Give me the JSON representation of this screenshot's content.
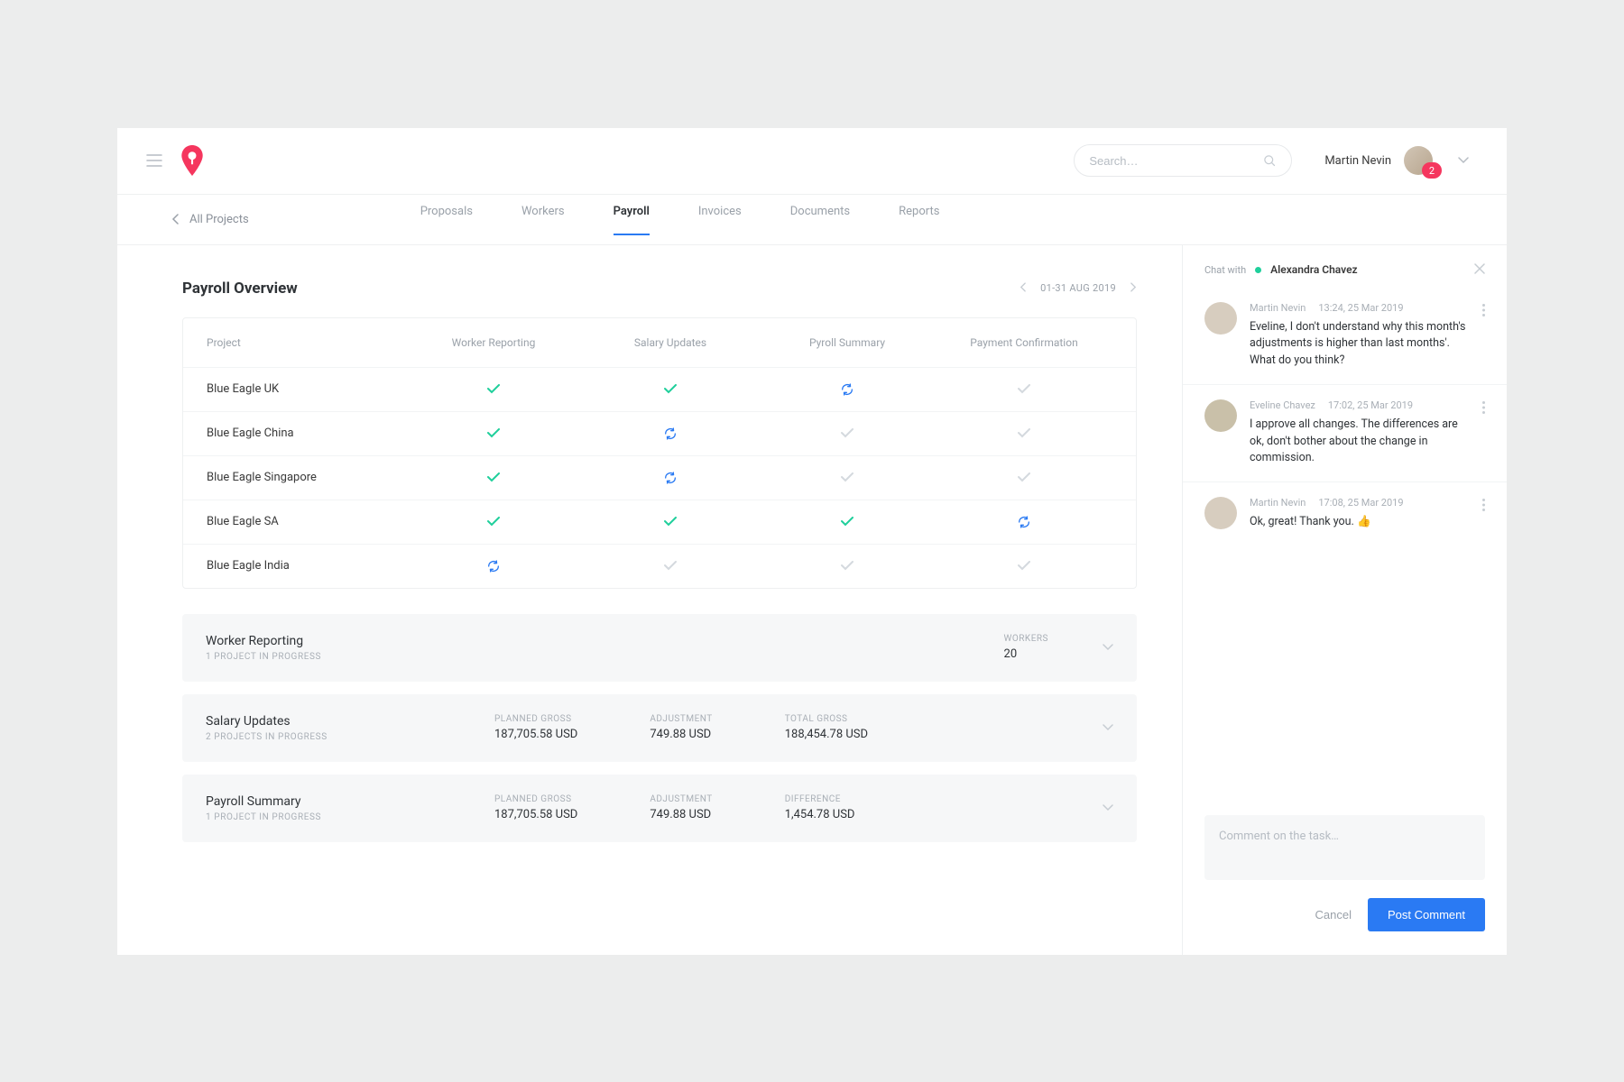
{
  "topbar": {
    "search_placeholder": "Search…",
    "user_name": "Martin Nevin",
    "notification_count": "2"
  },
  "subnav": {
    "back_label": "All Projects",
    "tabs": {
      "proposals": "Proposals",
      "workers": "Workers",
      "payroll": "Payroll",
      "invoices": "Invoices",
      "documents": "Documents",
      "reports": "Reports"
    }
  },
  "overview": {
    "title": "Payroll Overview",
    "date_range": "01-31 AUG 2019",
    "columns": {
      "project": "Project",
      "worker_reporting": "Worker Reporting",
      "salary_updates": "Salary Updates",
      "payroll_summary": "Pyroll Summary",
      "payment_confirmation": "Payment Confirmation"
    },
    "rows": {
      "r0": {
        "name": "Blue Eagle UK"
      },
      "r1": {
        "name": "Blue Eagle China"
      },
      "r2": {
        "name": "Blue Eagle Singapore"
      },
      "r3": {
        "name": "Blue Eagle SA"
      },
      "r4": {
        "name": "Blue Eagle India"
      }
    }
  },
  "cards": {
    "worker_reporting": {
      "title": "Worker Reporting",
      "sub": "1 PROJECT IN PROGRESS",
      "metric1_label": "WORKERS",
      "metric1_value": "20"
    },
    "salary_updates": {
      "title": "Salary Updates",
      "sub": "2 PROJECTS IN PROGRESS",
      "metric1_label": "PLANNED GROSS",
      "metric1_value": "187,705.58 USD",
      "metric2_label": "ADJUSTMENT",
      "metric2_value": "749.88 USD",
      "metric3_label": "TOTAL GROSS",
      "metric3_value": "188,454.78 USD"
    },
    "payroll_summary": {
      "title": "Payroll Summary",
      "sub": "1 PROJECT IN PROGRESS",
      "metric1_label": "PLANNED GROSS",
      "metric1_value": "187,705.58 USD",
      "metric2_label": "ADJUSTMENT",
      "metric2_value": "749.88 USD",
      "metric3_label": "DIFFERENCE",
      "metric3_value": "1,454.78 USD"
    }
  },
  "chat": {
    "label": "Chat with",
    "participant": "Alexandra Chavez",
    "messages": {
      "m0": {
        "author": "Martin Nevin",
        "time": "13:24, 25 Mar 2019",
        "text": "Eveline, I don't understand why this month's adjustments is higher than last months'. What do you think?"
      },
      "m1": {
        "author": "Eveline Chavez",
        "time": "17:02, 25 Mar 2019",
        "text": "I approve all changes. The differences are ok, don't bother about the change in commission."
      },
      "m2": {
        "author": "Martin Nevin",
        "time": "17:08, 25 Mar 2019",
        "text": "Ok, great! Thank you. 👍"
      }
    },
    "comment_placeholder": "Comment on the task…",
    "cancel_label": "Cancel",
    "post_label": "Post Comment"
  }
}
